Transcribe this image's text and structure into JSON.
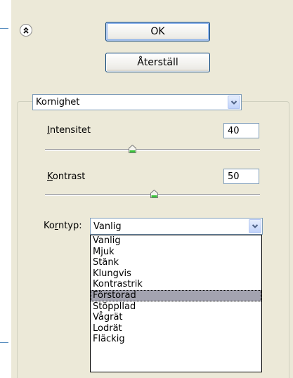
{
  "buttons": {
    "ok": "OK",
    "reset": "Återställ"
  },
  "filter_select": {
    "value": "Kornighet"
  },
  "intensity": {
    "label_u": "I",
    "label_rest": "ntensitet",
    "value": "40",
    "level_pct": 40
  },
  "contrast": {
    "label_u": "K",
    "label_rest": "ontrast",
    "value": "50",
    "level_pct": 50
  },
  "grain_type": {
    "label_pre": "Ko",
    "label_u": "r",
    "label_post": "ntyp:",
    "value": "Vanlig",
    "options": [
      "Vanlig",
      "Mjuk",
      "Stänk",
      "Klungvis",
      "Kontrastrik",
      "Förstorad",
      "Stöppllad",
      "Vågrät",
      "Lodrät",
      "Fläckig"
    ],
    "highlighted_index": 5
  },
  "colors": {
    "accent_border": "#003c74",
    "highlight": "#a3a3b0",
    "panel_bg": "#ece9d8"
  }
}
